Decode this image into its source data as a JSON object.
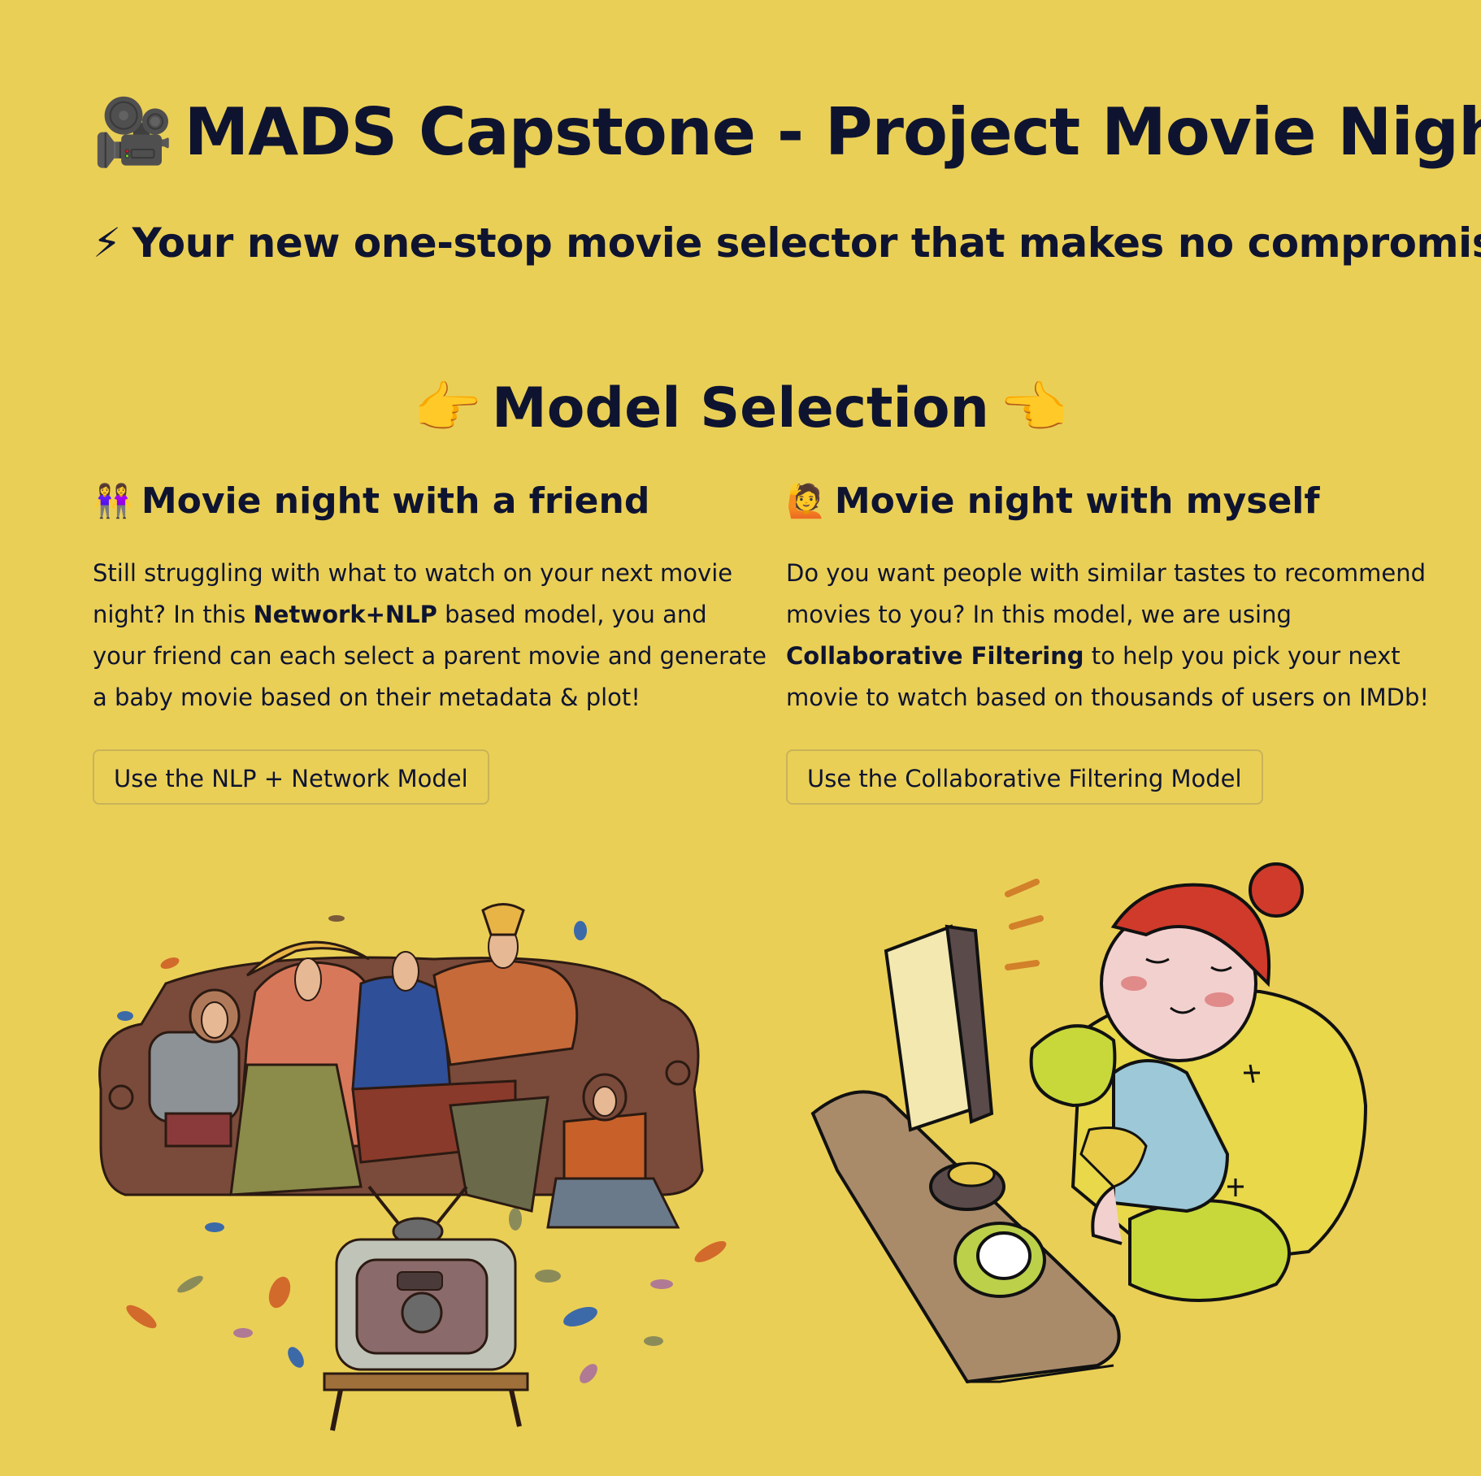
{
  "header": {
    "title_icon": "movie-camera-icon",
    "title": "MADS Capstone - Project Movie Night",
    "subtitle_icon": "lightning-icon",
    "subtitle": "Your new one-stop movie selector that makes no compromise!"
  },
  "section": {
    "left_icon": "point-right-icon",
    "title": "Model Selection",
    "right_icon": "point-left-icon"
  },
  "friend_model": {
    "icon": "two-women-icon",
    "heading": "Movie night with a friend",
    "text_1": "Still struggling with what to watch on your next movie night? In this ",
    "text_bold": "Network+NLP",
    "text_2": " based model, you and your friend can each select a parent movie and generate a baby movie based on their metadata & plot!",
    "button_label": "Use the NLP + Network Model"
  },
  "self_model": {
    "icon": "raising-hand-icon",
    "heading": "Movie night with myself",
    "text_1": "Do you want people with similar tastes to recommend movies to you? In this model, we are using ",
    "text_bold": "Collaborative Filtering",
    "text_2": " to help you pick your next movie to watch based on thousands of users on IMDb!",
    "button_label": "Use the Collaborative Filtering Model"
  },
  "colors": {
    "background": "#eacf56",
    "text": "#0e1430",
    "button_border": "#c9b35a"
  }
}
